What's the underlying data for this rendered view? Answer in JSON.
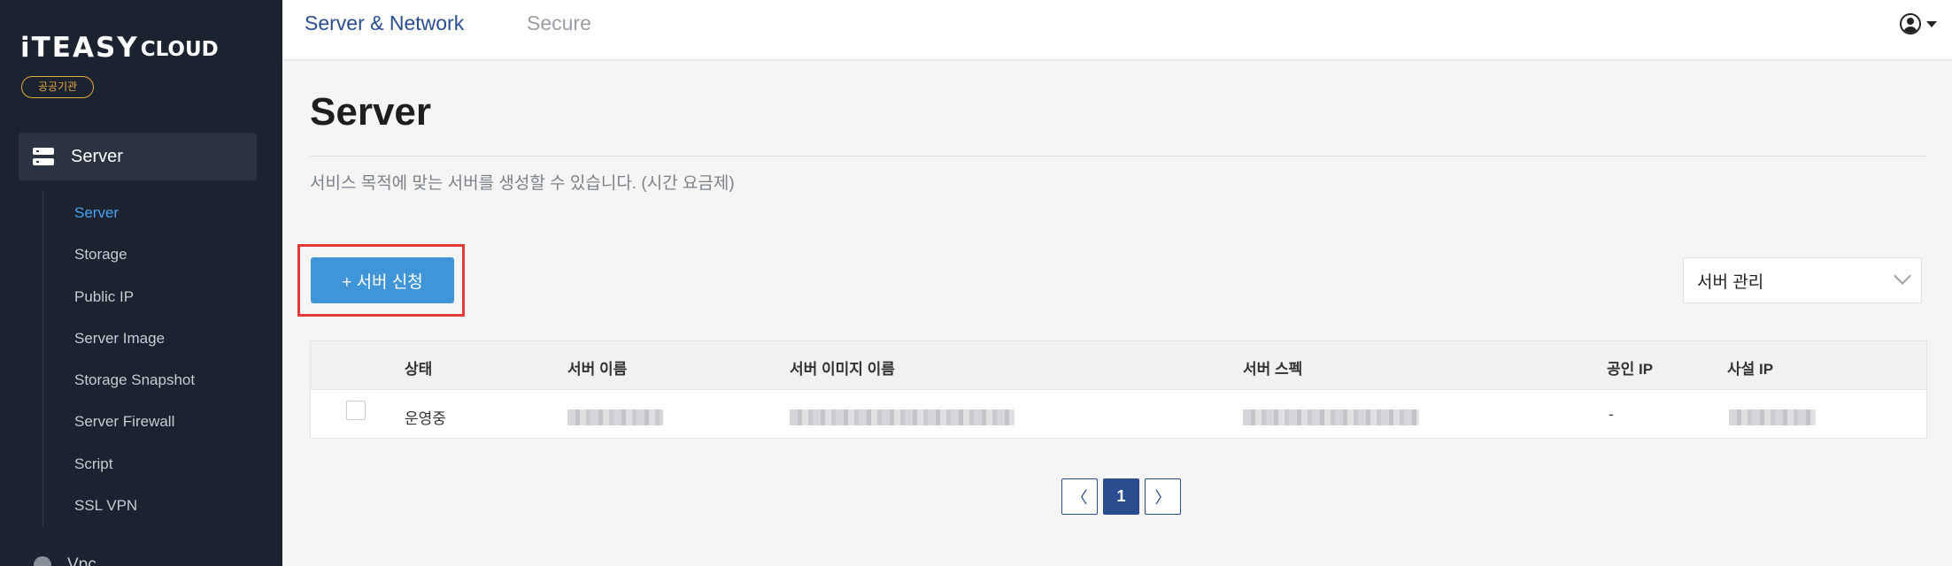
{
  "brand": {
    "logo_main": "iTEASY",
    "logo_sub": "CLOUD",
    "badge": "공공기관"
  },
  "sidebar": {
    "active_section": "Server",
    "items": [
      {
        "label": "Server",
        "active": true
      },
      {
        "label": "Storage"
      },
      {
        "label": "Public IP"
      },
      {
        "label": "Server Image"
      },
      {
        "label": "Storage Snapshot"
      },
      {
        "label": "Server Firewall"
      },
      {
        "label": "Script"
      },
      {
        "label": "SSL VPN"
      }
    ],
    "next_section": "Vpc"
  },
  "header": {
    "tabs": [
      {
        "label": "Server & Network",
        "active": true
      },
      {
        "label": "Secure"
      }
    ]
  },
  "page": {
    "title": "Server",
    "description": "서비스 목적에 맞는 서버를 생성할 수 있습니다. (시간 요금제)",
    "create_button": "+ 서버 신청",
    "manage_select": "서버 관리"
  },
  "table": {
    "columns": [
      "상태",
      "서버 이름",
      "서버 이미지 이름",
      "서버 스펙",
      "공인 IP",
      "사설 IP"
    ],
    "rows": [
      {
        "status": "운영중",
        "name": "",
        "image": "",
        "spec": "",
        "public_ip": "-",
        "private_ip": ""
      }
    ]
  },
  "pagination": {
    "prev": "〈",
    "current": "1",
    "next": "〉"
  },
  "colors": {
    "sidebar_bg": "#1b2230",
    "accent_blue": "#4095d8",
    "active_link": "#4aa3f0",
    "header_active": "#2a4d8f",
    "highlight": "#e53935",
    "badge": "#e8a93a"
  }
}
